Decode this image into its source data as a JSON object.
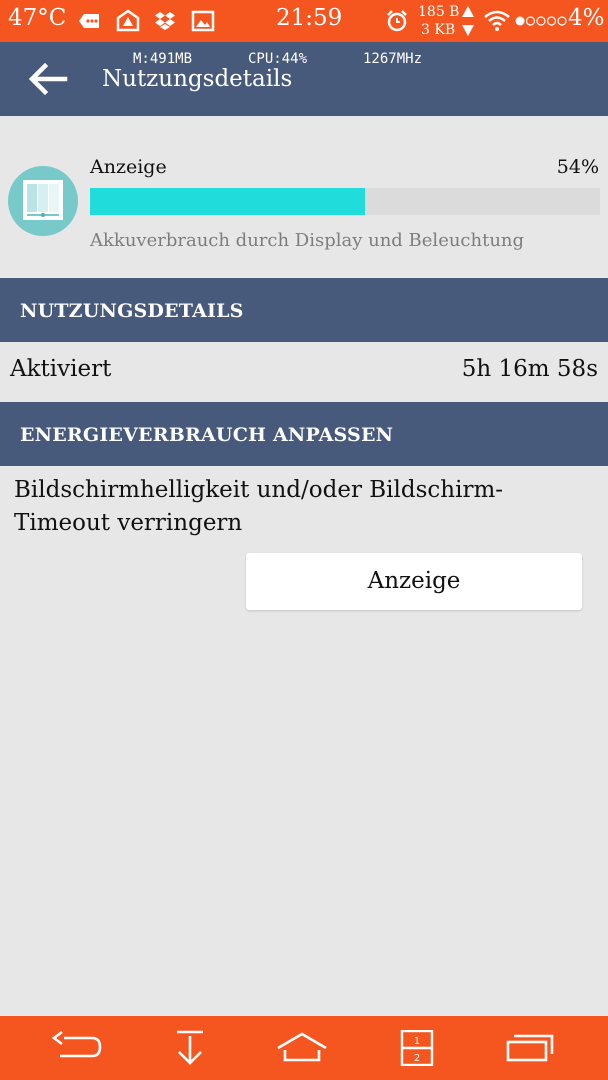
{
  "status_bar": {
    "temperature": "47°C",
    "time": "21:59",
    "net_up": "185 B",
    "net_down": "3 KB",
    "battery": "4%",
    "icons": [
      "message-icon",
      "app-icon",
      "dropbox-icon",
      "image-icon",
      "alarm-icon",
      "upload-arrow-icon",
      "download-arrow-icon",
      "wifi-icon",
      "signal-icon"
    ]
  },
  "app_bar": {
    "memory": "M:491MB",
    "cpu": "CPU:44%",
    "freq": "1267MHz",
    "title": "Nutzungsdetails",
    "back_icon": "arrow-left-icon"
  },
  "usage": {
    "icon": "display-icon",
    "label": "Anzeige",
    "percent_text": "54%",
    "percent_value": 54,
    "description": "Akkuverbrauch durch Display und Beleuchtung"
  },
  "sections": {
    "usage_details_header": "NUTZUNGSDETAILS",
    "activated_label": "Aktiviert",
    "activated_value": "5h 16m 58s",
    "adjust_header": "ENERGIEVERBRAUCH ANPASSEN",
    "tip": "Bildschirmhelligkeit und/oder Bildschirm-Timeout verringern",
    "button_label": "Anzeige"
  },
  "nav_bar": {
    "icons": [
      "back-icon",
      "download-icon",
      "home-icon",
      "split-screen-icon",
      "recent-apps-icon"
    ]
  },
  "colors": {
    "accent": "#f5561f",
    "header": "#485a7c",
    "progress": "#20dcdb",
    "background": "#e6e7e6"
  }
}
